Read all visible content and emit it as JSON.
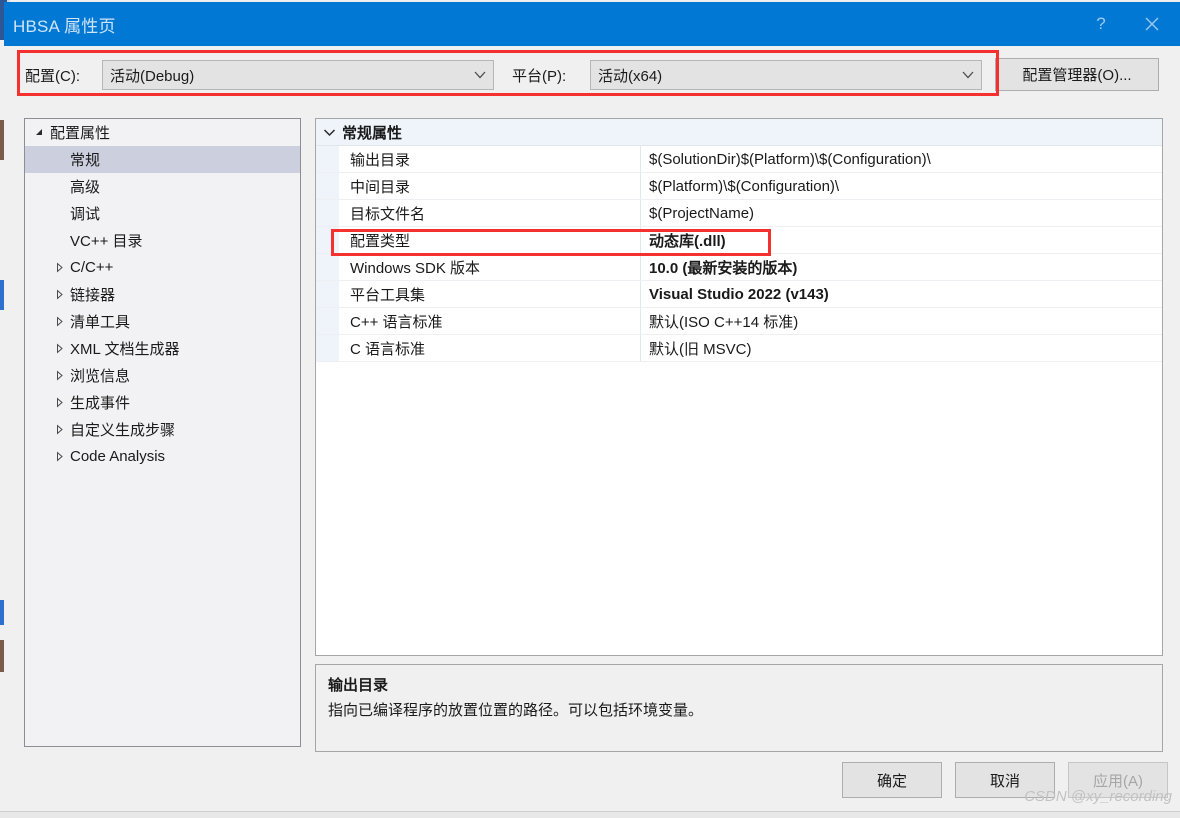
{
  "window": {
    "title": "HBSA 属性页",
    "help_label": "?",
    "close_label": "✕",
    "accent_color": "#0078d4",
    "annotation_color": "#f4312e"
  },
  "toolbar": {
    "config_label": "配置(C):",
    "config_value": "活动(Debug)",
    "platform_label": "平台(P):",
    "platform_value": "活动(x64)",
    "config_manager_label": "配置管理器(O)...",
    "chevron": "⌄"
  },
  "tree": {
    "items": [
      {
        "label": "配置属性",
        "level": 0,
        "arrow": "▲",
        "expanded": true,
        "selected": false
      },
      {
        "label": "常规",
        "level": 1,
        "arrow": "",
        "expanded": false,
        "selected": true
      },
      {
        "label": "高级",
        "level": 1,
        "arrow": "",
        "expanded": false,
        "selected": false
      },
      {
        "label": "调试",
        "level": 1,
        "arrow": "",
        "expanded": false,
        "selected": false
      },
      {
        "label": "VC++ 目录",
        "level": 1,
        "arrow": "",
        "expanded": false,
        "selected": false
      },
      {
        "label": "C/C++",
        "level": 1,
        "arrow": "▷",
        "expanded": false,
        "selected": false
      },
      {
        "label": "链接器",
        "level": 1,
        "arrow": "▷",
        "expanded": false,
        "selected": false
      },
      {
        "label": "清单工具",
        "level": 1,
        "arrow": "▷",
        "expanded": false,
        "selected": false
      },
      {
        "label": "XML 文档生成器",
        "level": 1,
        "arrow": "▷",
        "expanded": false,
        "selected": false
      },
      {
        "label": "浏览信息",
        "level": 1,
        "arrow": "▷",
        "expanded": false,
        "selected": false
      },
      {
        "label": "生成事件",
        "level": 1,
        "arrow": "▷",
        "expanded": false,
        "selected": false
      },
      {
        "label": "自定义生成步骤",
        "level": 1,
        "arrow": "▷",
        "expanded": false,
        "selected": false
      },
      {
        "label": "Code Analysis",
        "level": 1,
        "arrow": "▷",
        "expanded": false,
        "selected": false
      }
    ]
  },
  "grid": {
    "category": "常规属性",
    "category_chevron": "⌄",
    "rows": [
      {
        "name": "输出目录",
        "value": "$(SolutionDir)$(Platform)\\$(Configuration)\\",
        "bold": false,
        "highlighted": false
      },
      {
        "name": "中间目录",
        "value": "$(Platform)\\$(Configuration)\\",
        "bold": false,
        "highlighted": false
      },
      {
        "name": "目标文件名",
        "value": "$(ProjectName)",
        "bold": false,
        "highlighted": false
      },
      {
        "name": "配置类型",
        "value": "动态库(.dll)",
        "bold": true,
        "highlighted": true
      },
      {
        "name": "Windows SDK 版本",
        "value": "10.0 (最新安装的版本)",
        "bold": true,
        "highlighted": false
      },
      {
        "name": "平台工具集",
        "value": "Visual Studio 2022 (v143)",
        "bold": true,
        "highlighted": false
      },
      {
        "name": "C++ 语言标准",
        "value": "默认(ISO C++14 标准)",
        "bold": false,
        "highlighted": false
      },
      {
        "name": "C 语言标准",
        "value": "默认(旧 MSVC)",
        "bold": false,
        "highlighted": false
      }
    ]
  },
  "description": {
    "title": "输出目录",
    "body": "指向已编译程序的放置位置的路径。可以包括环境变量。"
  },
  "footer": {
    "ok_label": "确定",
    "cancel_label": "取消",
    "apply_label": "应用(A)",
    "apply_disabled": true
  },
  "watermark": {
    "text": "CSDN @xy_recording"
  }
}
